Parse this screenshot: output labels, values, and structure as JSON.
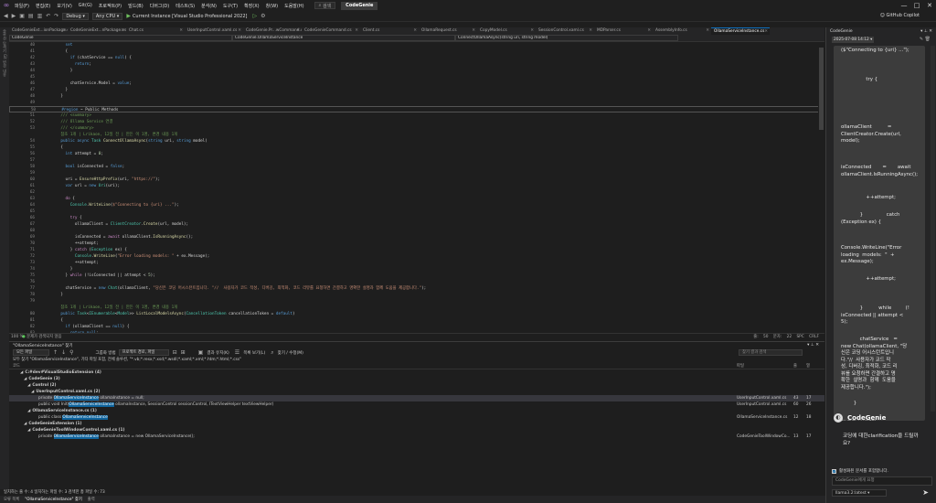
{
  "menu": [
    "파일(F)",
    "편집(E)",
    "보기(V)",
    "Git(G)",
    "프로젝트(P)",
    "빌드(B)",
    "디버그(D)",
    "테스트(S)",
    "분석(N)",
    "도구(T)",
    "확장(X)",
    "창(W)",
    "도움말(H)"
  ],
  "search_label": "검색",
  "solution_name": "CodeGenie",
  "toolbar": {
    "config": "Debug",
    "platform": "Any CPU",
    "run_target": "Current Instance [Visual Studio Professional 2022]",
    "copilot": "GitHub Copilot"
  },
  "tabs": [
    "CodeGenieExt...ionPackage.cs",
    "CodeGenieExt...nPackage.vsct",
    "Chat.cs",
    "UserInputControl.xaml.cs",
    "CodeGenie.Pr...wCommand.cs",
    "CodeGenieCommand.cs",
    "Client.cs",
    "OllamaRequest.cs",
    "CopyModel.cs",
    "SessionControl.xaml.cs",
    "MDParser.cs",
    "AssemblyInfo.cs",
    "OllamaServiceInstance.cs"
  ],
  "leftstrip": [
    "솔루션 탐색기",
    "Git 변경 내용"
  ],
  "nav": {
    "project": "CodeGenie",
    "class": "CodeGenie.OllamaServiceInstance",
    "member": "ConnectOllamaAsync(string uri, string model)"
  },
  "code_lines": [
    {
      "n": "40",
      "g": "",
      "h": [
        [
          "      ",
          ""
        ],
        [
          "set",
          "k"
        ]
      ]
    },
    {
      "n": "41",
      "g": "",
      "h": [
        [
          "      {",
          ""
        ]
      ]
    },
    {
      "n": "42",
      "g": "",
      "h": [
        [
          "        ",
          ""
        ],
        [
          "if",
          "k"
        ],
        [
          " (chatService == ",
          ""
        ],
        [
          "null",
          "k"
        ],
        [
          ") {",
          ""
        ]
      ]
    },
    {
      "n": "43",
      "g": "",
      "h": [
        [
          "          ",
          ""
        ],
        [
          "return",
          "k"
        ],
        [
          ";",
          ""
        ]
      ]
    },
    {
      "n": "44",
      "g": "",
      "h": [
        [
          "        }",
          ""
        ]
      ]
    },
    {
      "n": "45",
      "g": "",
      "h": [
        [
          "",
          ""
        ]
      ]
    },
    {
      "n": "46",
      "g": "",
      "h": [
        [
          "        chatService.Model = ",
          ""
        ],
        [
          "value",
          "k"
        ],
        [
          ";",
          ""
        ]
      ]
    },
    {
      "n": "47",
      "g": "",
      "h": [
        [
          "      }",
          ""
        ]
      ]
    },
    {
      "n": "48",
      "g": "",
      "h": [
        [
          "    }",
          ""
        ]
      ]
    },
    {
      "n": "49",
      "g": "",
      "h": [
        [
          "",
          ""
        ]
      ]
    },
    {
      "n": "50",
      "g": "",
      "hl": true,
      "h": [
        [
          "    #region",
          "k"
        ],
        [
          " ~ Public Methods",
          ""
        ]
      ]
    },
    {
      "n": "51",
      "g": "",
      "h": [
        [
          "    /// <summary>",
          "c"
        ]
      ]
    },
    {
      "n": "52",
      "g": "",
      "h": [
        [
          "    /// Ollama Service 연결",
          "c"
        ]
      ]
    },
    {
      "n": "53",
      "g": "",
      "h": [
        [
          "    /// </summary>",
          "c"
        ]
      ]
    },
    {
      "n": "",
      "g": "",
      "h": [
        [
          "    참조 1개 | Lrikaon, 12일 전 | 만든 이 1명, 변경 내용 1개",
          "c"
        ]
      ]
    },
    {
      "n": "54",
      "g": "",
      "h": [
        [
          "    ",
          ""
        ],
        [
          "public async",
          "k"
        ],
        [
          " ",
          ""
        ],
        [
          "Task",
          "t"
        ],
        [
          " ",
          ""
        ],
        [
          "ConnectOllamaAsync",
          "m"
        ],
        [
          "(",
          ""
        ],
        [
          "string",
          "k"
        ],
        [
          " uri, ",
          ""
        ],
        [
          "string",
          "k"
        ],
        [
          " model)",
          ""
        ]
      ]
    },
    {
      "n": "55",
      "g": "",
      "h": [
        [
          "    {",
          ""
        ]
      ]
    },
    {
      "n": "56",
      "g": "",
      "h": [
        [
          "      ",
          ""
        ],
        [
          "int",
          "k"
        ],
        [
          " attempt = ",
          ""
        ],
        [
          "0",
          "n"
        ],
        [
          ";",
          ""
        ]
      ]
    },
    {
      "n": "57",
      "g": "",
      "h": [
        [
          "",
          ""
        ]
      ]
    },
    {
      "n": "58",
      "g": "",
      "h": [
        [
          "      ",
          ""
        ],
        [
          "bool",
          "k"
        ],
        [
          " isConnected = ",
          ""
        ],
        [
          "false",
          "k"
        ],
        [
          ";",
          ""
        ]
      ]
    },
    {
      "n": "59",
      "g": "",
      "h": [
        [
          "",
          ""
        ]
      ]
    },
    {
      "n": "60",
      "g": "",
      "h": [
        [
          "      uri = ",
          ""
        ],
        [
          "EnsureHttpPrefix",
          "m"
        ],
        [
          "(uri, ",
          ""
        ],
        [
          "\"https://\"",
          "s"
        ],
        [
          ");",
          ""
        ]
      ]
    },
    {
      "n": "61",
      "g": "",
      "h": [
        [
          "      ",
          ""
        ],
        [
          "var",
          "k"
        ],
        [
          " url = ",
          ""
        ],
        [
          "new",
          "k"
        ],
        [
          " ",
          ""
        ],
        [
          "Uri",
          "t"
        ],
        [
          "(uri);",
          ""
        ]
      ]
    },
    {
      "n": "62",
      "g": "",
      "h": [
        [
          "",
          ""
        ]
      ]
    },
    {
      "n": "63",
      "g": "",
      "h": [
        [
          "      ",
          ""
        ],
        [
          "do",
          "r"
        ],
        [
          " {",
          ""
        ]
      ]
    },
    {
      "n": "64",
      "g": "",
      "h": [
        [
          "        ",
          ""
        ],
        [
          "Console",
          "t"
        ],
        [
          ".",
          ""
        ],
        [
          "WriteLine",
          "m"
        ],
        [
          "(",
          ""
        ],
        [
          "$\"Connecting to {uri} ...\"",
          "s"
        ],
        [
          ");",
          ""
        ]
      ]
    },
    {
      "n": "65",
      "g": "",
      "h": [
        [
          "",
          ""
        ]
      ]
    },
    {
      "n": "66",
      "g": "",
      "h": [
        [
          "        ",
          ""
        ],
        [
          "try",
          "r"
        ],
        [
          " {",
          ""
        ]
      ]
    },
    {
      "n": "67",
      "g": "",
      "h": [
        [
          "          ollamaClient = ",
          ""
        ],
        [
          "ClientCreator",
          "t"
        ],
        [
          ".",
          ""
        ],
        [
          "Create",
          "m"
        ],
        [
          "(url, model);",
          ""
        ]
      ]
    },
    {
      "n": "68",
      "g": "",
      "h": [
        [
          "",
          ""
        ]
      ]
    },
    {
      "n": "69",
      "g": "",
      "h": [
        [
          "          isConnected = ",
          ""
        ],
        [
          "await",
          "r"
        ],
        [
          " ollamaClient.",
          ""
        ],
        [
          "IsRunningAsync",
          "m"
        ],
        [
          "();",
          ""
        ]
      ]
    },
    {
      "n": "70",
      "g": "",
      "h": [
        [
          "          ++attempt;",
          ""
        ]
      ]
    },
    {
      "n": "71",
      "g": "",
      "h": [
        [
          "        } ",
          ""
        ],
        [
          "catch",
          "r"
        ],
        [
          " (",
          ""
        ],
        [
          "Exception",
          "t"
        ],
        [
          " ex) {",
          ""
        ]
      ]
    },
    {
      "n": "72",
      "g": "",
      "h": [
        [
          "          ",
          ""
        ],
        [
          "Console",
          "t"
        ],
        [
          ".",
          ""
        ],
        [
          "WriteLine",
          "m"
        ],
        [
          "(",
          ""
        ],
        [
          "\"Error loading models: \"",
          "s"
        ],
        [
          " + ex.Message);",
          ""
        ]
      ]
    },
    {
      "n": "73",
      "g": "",
      "h": [
        [
          "          ++attempt;",
          ""
        ]
      ]
    },
    {
      "n": "74",
      "g": "",
      "h": [
        [
          "        }",
          ""
        ]
      ]
    },
    {
      "n": "75",
      "g": "",
      "h": [
        [
          "      } ",
          ""
        ],
        [
          "while",
          "r"
        ],
        [
          " (!isConnected || attempt < ",
          ""
        ],
        [
          "5",
          "n"
        ],
        [
          ");",
          ""
        ]
      ]
    },
    {
      "n": "76",
      "g": "",
      "h": [
        [
          "",
          ""
        ]
      ]
    },
    {
      "n": "77",
      "g": "",
      "h": [
        [
          "      chatService = ",
          ""
        ],
        [
          "new",
          "k"
        ],
        [
          " ",
          ""
        ],
        [
          "Chat",
          "t"
        ],
        [
          "(ollamaClient, ",
          ""
        ],
        [
          "\"당신은 코딩 어시스턴트입니다. \"//  사용자가 코드 작성, 디버깅, 최적화, 코드 리뷰를 요청하면 간결하고 명확한 설명과 함께 도움을 제공합니다.\"",
          "s"
        ],
        [
          ");",
          ""
        ]
      ]
    },
    {
      "n": "78",
      "g": "",
      "h": [
        [
          "    }",
          ""
        ]
      ]
    },
    {
      "n": "79",
      "g": "",
      "h": [
        [
          "",
          ""
        ]
      ]
    },
    {
      "n": "",
      "g": "",
      "h": [
        [
          "    참조 1개 | Lrikaon, 12일 전 | 만든 이 1명, 변경 내용 1개",
          "c"
        ]
      ]
    },
    {
      "n": "80",
      "g": "",
      "h": [
        [
          "    ",
          ""
        ],
        [
          "public",
          "k"
        ],
        [
          " ",
          ""
        ],
        [
          "Task",
          "t"
        ],
        [
          "<",
          ""
        ],
        [
          "IEnumerable",
          "t"
        ],
        [
          "<",
          ""
        ],
        [
          "Model",
          "t"
        ],
        [
          ">> ",
          ""
        ],
        [
          "ListLocalModelsAsync",
          "m"
        ],
        [
          "(",
          ""
        ],
        [
          "CancellationToken",
          "t"
        ],
        [
          " cancellationToken = ",
          ""
        ],
        [
          "default",
          "k"
        ],
        [
          ")",
          ""
        ]
      ]
    },
    {
      "n": "81",
      "g": "",
      "h": [
        [
          "    {",
          ""
        ]
      ]
    },
    {
      "n": "82",
      "g": "",
      "h": [
        [
          "      ",
          ""
        ],
        [
          "if",
          "k"
        ],
        [
          " (ollamaClient == ",
          ""
        ],
        [
          "null",
          "k"
        ],
        [
          ") {",
          ""
        ]
      ]
    },
    {
      "n": "83",
      "g": "",
      "h": [
        [
          "        ",
          ""
        ],
        [
          "return null",
          "k"
        ],
        [
          ";",
          ""
        ]
      ]
    }
  ],
  "editor_status": {
    "zoom": "100 %",
    "errors": "문제가 검색되지 않음",
    "line": "줄: 50",
    "col": "문자: 22",
    "spc": "SPC",
    "crlf": "CRLF"
  },
  "find": {
    "title": "\"OllamaServiceInstance\" 찾기",
    "scope": "모든 파일",
    "group_label": "그룹화 방법",
    "group_value": "프로젝트 경로, 파일",
    "keep_results": "결과 유지(K)",
    "list_view": "목록 보기(L)",
    "find_replace": "찾기 / 수정(M)",
    "search_results_placeholder": "찾기 결과 검색",
    "summary": "모두 찾기 \"OllamaServiceInstance\", 기타 파일 포함, 전체 솔루션, \"*.vb;*.resx;*.xsd;*.wsdl;*.xaml;*.xml;*.htm;*.html;*.css\"",
    "col_code": "코드",
    "col_file": "파일",
    "col_line": "줄",
    "col_col": "열",
    "footer": "일치하는 줄 수: 4  일치하는 파일 수: 3  검색한 총 파일 수: 73",
    "rows": [
      {
        "indent": 2,
        "exp": "◢",
        "pre": "C:#dev#VisualStudioExtension (4)",
        "mark": "",
        "post": "",
        "file": "",
        "line": "",
        "col": "",
        "bold": true
      },
      {
        "indent": 3,
        "exp": "◢",
        "pre": "CodeGenie (3)",
        "mark": "",
        "post": "",
        "file": "",
        "line": "",
        "col": "",
        "bold": true
      },
      {
        "indent": 4,
        "exp": "◢",
        "pre": "Control (2)",
        "mark": "",
        "post": "",
        "file": "",
        "line": "",
        "col": "",
        "bold": true
      },
      {
        "indent": 5,
        "exp": "◢",
        "pre": "UserInputControl.xaml.cs (2)",
        "mark": "",
        "post": "",
        "file": "",
        "line": "",
        "col": "",
        "bold": true
      },
      {
        "indent": 7,
        "exp": "",
        "pre": "private ",
        "mark": "OllamaServiceInstance",
        "post": " ollamaInstance = null;",
        "file": "UserInputControl.xaml.cs",
        "line": "43",
        "col": "17",
        "sel": true
      },
      {
        "indent": 7,
        "exp": "",
        "pre": "public void Init(",
        "mark": "OllamaServiceInstance",
        "post": " ollamaInstance, SessionControl sessionControl, ITextViewHelper textViewHelper)",
        "file": "UserInputControl.xaml.cs",
        "line": "60",
        "col": "26"
      },
      {
        "indent": 4,
        "exp": "◢",
        "pre": "OllamaServiceInstance.cs (1)",
        "mark": "",
        "post": "",
        "file": "",
        "line": "",
        "col": "",
        "bold": true
      },
      {
        "indent": 7,
        "exp": "",
        "pre": "public class ",
        "mark": "OllamaServiceInstance",
        "post": "",
        "file": "OllamaServiceInstance.cs",
        "line": "12",
        "col": "18"
      },
      {
        "indent": 3,
        "exp": "◢",
        "pre": "CodeGenieExtension (1)",
        "mark": "",
        "post": "",
        "file": "",
        "line": "",
        "col": "",
        "bold": true
      },
      {
        "indent": 4,
        "exp": "◢",
        "pre": "CodeGenieToolWindowControl.xaml.cs (1)",
        "mark": "",
        "post": "",
        "file": "",
        "line": "",
        "col": "",
        "bold": true
      },
      {
        "indent": 7,
        "exp": "",
        "pre": "private ",
        "mark": "OllamaServiceInstance",
        "post": " ollamaInstance = new OllamaServiceInstance();",
        "file": "CodeGenieToolWindowCo...",
        "line": "13",
        "col": "17"
      }
    ]
  },
  "bottom_tabs": [
    "오류 목록",
    "\"OllamaServiceInstance\" 찾기",
    "출력"
  ],
  "right": {
    "title": "CodeGenie",
    "date": "2025-07-08 14:12",
    "chat_texts": [
      "($\"Connecting to {uri} ...\");",
      "                try {",
      "ollamaClient          =\nClientCreator.Create(url,\nmodel);",
      "isConnected       =       await\nollamaClient.IsRunningAsync();",
      "                ++attempt;",
      "            }               catch\n(Exception ex) {",
      "Console.WriteLine(\"Error\nloading  models:  \"  +\nex.Message);",
      "                ++attempt;",
      "            }          while         (!\nisConnected || attempt <\n5);",
      "            chatService   =\nnew Chat(ollamaClient, \"당\n신은 코딩 어시스턴트입니\n다.\"//  사용자가 코드 작\n성, 디버깅, 최적화, 코드 리\n뷰를 요청하면 간결하고 명\n확한  설명과  함께  도움을\n제공합니다.\");",
      "        }",
      "이 코드 분석해줘"
    ],
    "bot_name": "CodeGenie",
    "bot_message": "코딩에 대한clarification을 드릴까요?",
    "checkbox_label": "활성화된 문서를 포함합니다.",
    "input_placeholder": "CodeGenie에게 요청",
    "model": "llama3.2:latest"
  }
}
